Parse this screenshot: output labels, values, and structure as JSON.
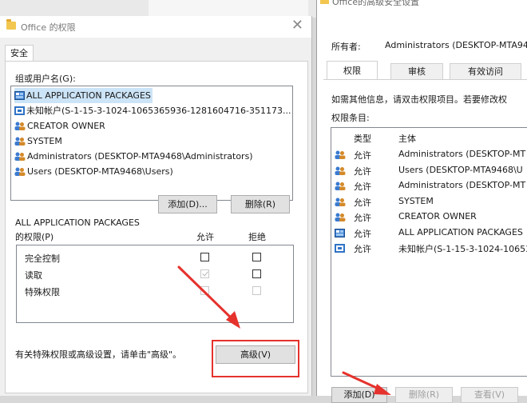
{
  "left_dialog": {
    "title": "Office 的权限",
    "tab": "安全",
    "group_label": "组或用户名(G):",
    "groups": [
      {
        "name": "ALL APPLICATION PACKAGES",
        "icon": "package-icon",
        "selected": true
      },
      {
        "name": "未知帐户(S-1-15-3-1024-1065365936-1281604716-351173...",
        "icon": "unknown-account-icon",
        "selected": false
      },
      {
        "name": "CREATOR OWNER",
        "icon": "users-icon",
        "selected": false
      },
      {
        "name": "SYSTEM",
        "icon": "users-icon",
        "selected": false
      },
      {
        "name": "Administrators (DESKTOP-MTA9468\\Administrators)",
        "icon": "users-icon",
        "selected": false
      },
      {
        "name": "Users (DESKTOP-MTA9468\\Users)",
        "icon": "users-icon",
        "selected": false
      }
    ],
    "add_button": "添加(D)...",
    "remove_button": "删除(R)",
    "perm_for_line1": "ALL APPLICATION PACKAGES",
    "perm_for_line2": "的权限(P)",
    "allow_header": "允许",
    "deny_header": "拒绝",
    "permissions": [
      {
        "name": "完全控制",
        "allow": "unchecked",
        "deny": "unchecked"
      },
      {
        "name": "读取",
        "allow": "checked-disabled",
        "deny": "unchecked"
      },
      {
        "name": "特殊权限",
        "allow": "disabled",
        "deny": "disabled"
      }
    ],
    "advanced_hint": "有关特殊权限或高级设置，请单击\"高级\"。",
    "advanced_button": "高级(V)"
  },
  "right_dialog": {
    "title": "Office的高级安全设置",
    "owner_label": "所有者:",
    "owner_value": "Administrators (DESKTOP-MTA946",
    "tabs": [
      "权限",
      "审核",
      "有效访问"
    ],
    "info_text": "如需其他信息，请双击权限项目。若要修改权",
    "entries_label": "权限条目:",
    "col_type": "类型",
    "col_principal": "主体",
    "entries": [
      {
        "type": "允许",
        "principal": "Administrators (DESKTOP-MT",
        "icon": "users-icon"
      },
      {
        "type": "允许",
        "principal": "Users (DESKTOP-MTA9468\\U",
        "icon": "users-icon"
      },
      {
        "type": "允许",
        "principal": "Administrators (DESKTOP-MT",
        "icon": "users-icon"
      },
      {
        "type": "允许",
        "principal": "SYSTEM",
        "icon": "users-icon"
      },
      {
        "type": "允许",
        "principal": "CREATOR OWNER",
        "icon": "users-icon"
      },
      {
        "type": "允许",
        "principal": "ALL APPLICATION PACKAGES",
        "icon": "package-icon"
      },
      {
        "type": "允许",
        "principal": "未知帐户(S-1-15-3-1024-10653",
        "icon": "unknown-account-icon"
      }
    ],
    "add_button": "添加(D)",
    "remove_button": "删除(R)",
    "view_button": "查看(V)"
  },
  "colors": {
    "highlight_red": "#e5322d",
    "selection": "#cce4f7"
  }
}
